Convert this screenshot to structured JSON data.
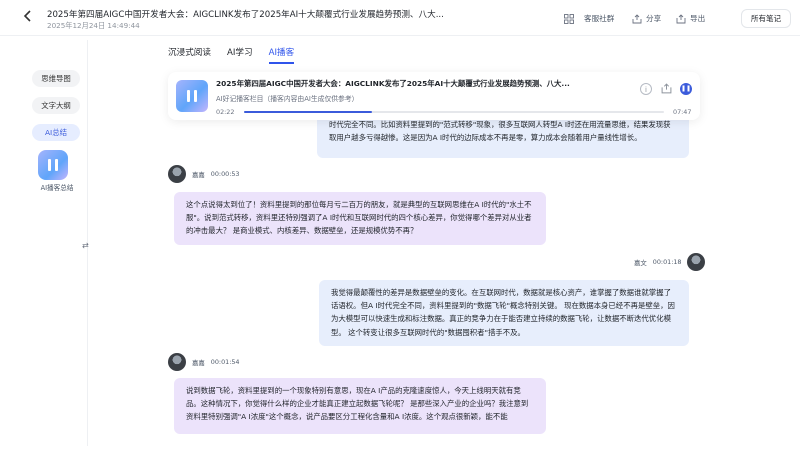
{
  "header": {
    "back_icon": "back-chevron-icon",
    "title": "2025年第四届AIGC中国开发者大会：AIGCLINK发布了2025年AI十大颠覆式行业发展趋势预测、八大...",
    "date": "2025年12月24日 14:49:44",
    "community": "客服社群",
    "share": "分享",
    "export": "导出",
    "all_notes": "所有笔记"
  },
  "sidebar": {
    "items": [
      {
        "label": "思维导图"
      },
      {
        "label": "文字大纲"
      },
      {
        "label": "AI总结"
      }
    ],
    "podcast_label": "AI播客总结",
    "toggle_icon": "⇄"
  },
  "tabs": [
    {
      "label": "沉浸式阅读"
    },
    {
      "label": "AI学习"
    },
    {
      "label": "AI播客"
    }
  ],
  "player": {
    "title": "2025年第四届AIGC中国开发者大会：AIGCLINK发布了2025年AI十大颠覆式行业发展趋势预测、八大...",
    "subtitle": "AI好记播客栏目（播客内容由AI生成仅供参考）",
    "current_time": "02:22",
    "total_time": "07:47",
    "progress_fraction": 0.305
  },
  "chat": [
    {
      "side": "right",
      "text": "时代完全不同。比如资料里提到的\"范式转移\"现象，很多互联网人转型A I时还在用流量思维，结果发现获取用户越多亏得越惨。这是因为A I时代的边际成本不再是零，算力成本会随着用户量线性增长。"
    },
    {
      "side": "left",
      "speaker": "嘉嘉",
      "time": "00:00:53",
      "text": "这个点说得太到位了！资料里提到的那位每月亏二百万的朋友，就是典型的互联网思维在A I时代的\"水土不服\"。说到范式转移，资料里还特别强调了A I时代和互联网时代的四个核心差异，你觉得哪个差异对从业者的冲击最大？ 是商业模式、内核差异、数据壁垒，还是规模优势不再？"
    },
    {
      "side": "right",
      "speaker": "嘉文",
      "time": "00:01:18",
      "text": "我觉得最颠覆性的差异是数据壁垒的变化。在互联网时代，数据就是核心资产，谁掌握了数据谁就掌握了话语权。但A I时代完全不同，资料里提到的\"数据飞轮\"概念特别关键。 现在数据本身已经不再是壁垒，因为大模型可以快速生成和标注数据。真正的竞争力在于能否建立持续的数据飞轮，让数据不断迭代优化模型。 这个转变让很多互联网时代的\"数据囤积者\"措手不及。"
    },
    {
      "side": "left",
      "speaker": "嘉嘉",
      "time": "00:01:54",
      "text": "说到数据飞轮，资料里提到的一个现象特别有意思，现在A I产品的克隆速度惊人，今天上线明天就有竞品。这种情况下，你觉得什么样的企业才能真正建立起数据飞轮呢？ 是那些深入产业的企业吗？我注意到资料里特别强调\"A I浓度\"这个概念，说产品要区分工程化含量和A I浓度。这个观点很新颖，能不能"
    }
  ]
}
